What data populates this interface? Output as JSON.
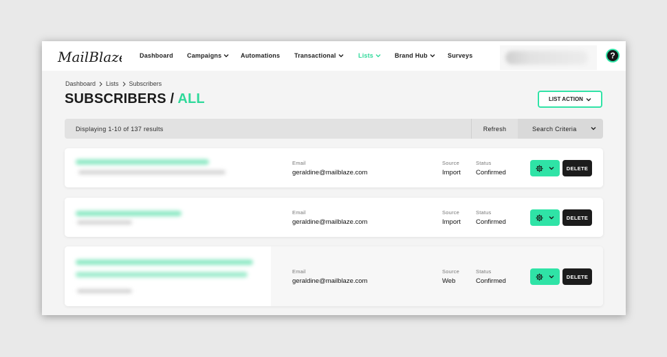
{
  "brand": {
    "logo_text": "MailBlaze",
    "accent_color": "#2ed99a"
  },
  "nav": {
    "items": [
      {
        "label": "Dashboard",
        "dropdown": false
      },
      {
        "label": "Campaigns",
        "dropdown": true
      },
      {
        "label": "Automations",
        "dropdown": false
      },
      {
        "label": "Transactional",
        "dropdown": true
      },
      {
        "label": "Lists",
        "dropdown": true,
        "active": true
      },
      {
        "label": "Brand Hub",
        "dropdown": true
      },
      {
        "label": "Surveys",
        "dropdown": false
      }
    ],
    "help_icon": "?"
  },
  "breadcrumb": [
    "Dashboard",
    "Lists",
    "Subscribers"
  ],
  "page": {
    "title_main": "SUBSCRIBERS / ",
    "title_accent": "ALL"
  },
  "list_action_label": "LIST ACTION",
  "results": {
    "text": "Displaying 1-10 of 137 results",
    "refresh_label": "Refresh",
    "search_label": "Search Criteria"
  },
  "subscribers": [
    {
      "email_label": "Email",
      "email": "geraldine@mailblaze.com",
      "source_label": "Source",
      "source": "Import",
      "status_label": "Status",
      "status": "Confirmed",
      "delete_label": "DELETE"
    },
    {
      "email_label": "Email",
      "email": "geraldine@mailblaze.com",
      "source_label": "Source",
      "source": "Import",
      "status_label": "Status",
      "status": "Confirmed",
      "delete_label": "DELETE"
    },
    {
      "email_label": "Email",
      "email": "geraldine@mailblaze.com",
      "source_label": "Source",
      "source": "Web",
      "status_label": "Status",
      "status": "Confirmed",
      "delete_label": "DELETE"
    }
  ]
}
